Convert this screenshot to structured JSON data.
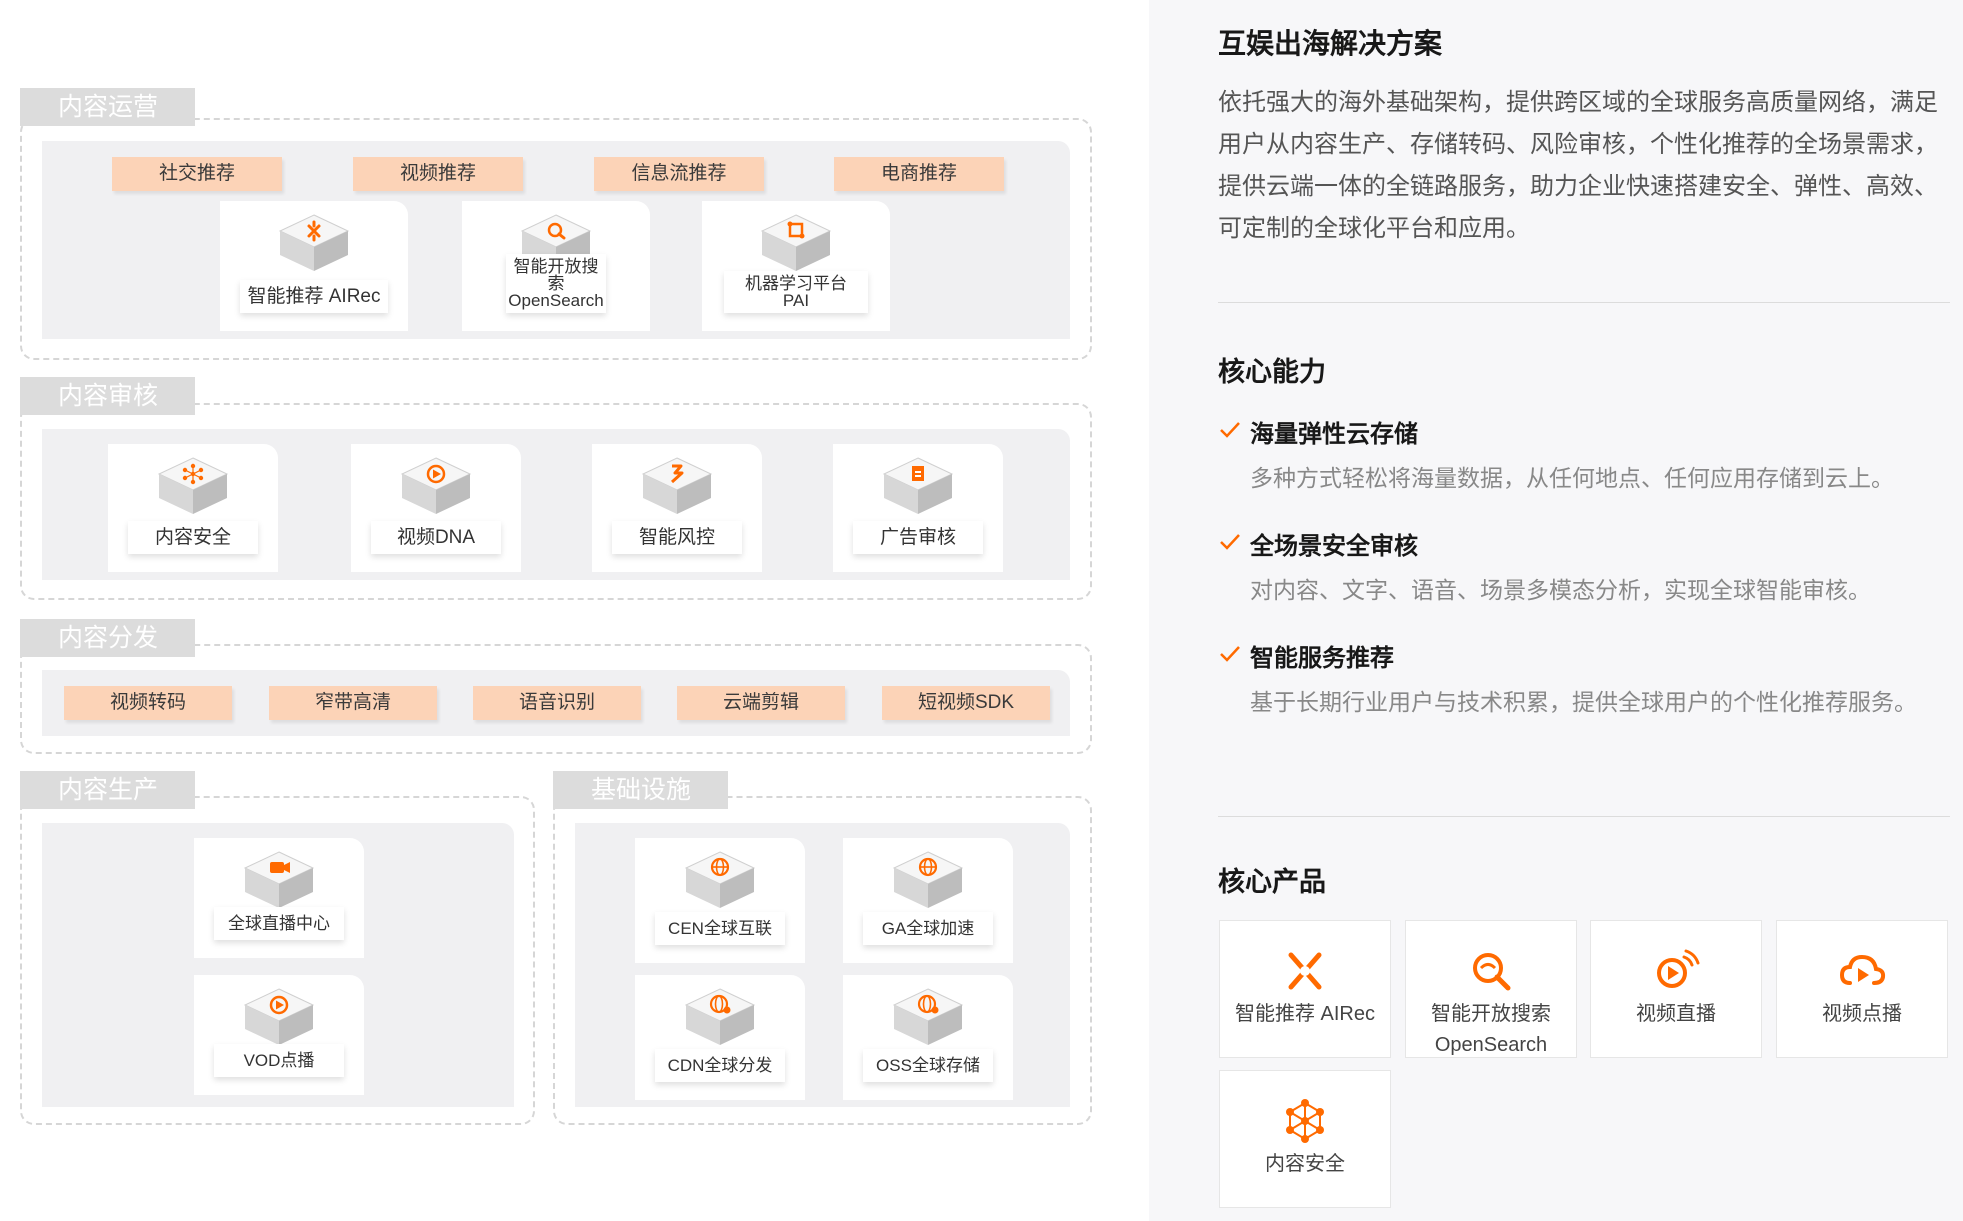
{
  "diagram": {
    "content_ops": {
      "title": "内容运营",
      "tags": [
        "社交推荐",
        "视频推荐",
        "信息流推荐",
        "电商推荐"
      ],
      "products": [
        {
          "name": "智能推荐 AIRec",
          "icon": "airec-icon"
        },
        {
          "line1": "智能开放搜索",
          "line2": "OpenSearch",
          "icon": "search-icon"
        },
        {
          "line1": "机器学习平台",
          "line2": "PAI",
          "icon": "pai-icon"
        }
      ]
    },
    "content_review": {
      "title": "内容审核",
      "products": [
        {
          "name": "内容安全",
          "icon": "network-icon"
        },
        {
          "name": "视频DNA",
          "icon": "video-play-icon"
        },
        {
          "name": "智能风控",
          "icon": "risk-control-icon"
        },
        {
          "name": "广告审核",
          "icon": "ad-review-icon"
        }
      ]
    },
    "content_dist": {
      "title": "内容分发",
      "tags": [
        "视频转码",
        "窄带高清",
        "语音识别",
        "云端剪辑",
        "短视频SDK"
      ]
    },
    "content_prod": {
      "title": "内容生产",
      "products": [
        {
          "name": "全球直播中心",
          "icon": "live-camera-icon"
        },
        {
          "name": "VOD点播",
          "icon": "vod-icon"
        }
      ]
    },
    "infra": {
      "title": "基础设施",
      "products": [
        {
          "name": "CEN全球互联",
          "icon": "globe-icon"
        },
        {
          "name": "GA全球加速",
          "icon": "globe-icon"
        },
        {
          "name": "CDN全球分发",
          "icon": "globe-gear-icon"
        },
        {
          "name": "OSS全球存储",
          "icon": "globe-gear-icon"
        }
      ]
    }
  },
  "solution": {
    "title": "互娱出海解决方案",
    "description": "依托强大的海外基础架构，提供跨区域的全球服务高质量网络，满足用户从内容生产、存储转码、风险审核，个性化推荐的全场景需求，提供云端一体的全链路服务，助力企业快速搭建安全、弹性、高效、可定制的全球化平台和应用。"
  },
  "capabilities": {
    "title": "核心能力",
    "items": [
      {
        "title": "海量弹性云存储",
        "desc": "多种方式轻松将海量数据，从任何地点、任何应用存储到云上。"
      },
      {
        "title": "全场景安全审核",
        "desc": "对内容、文字、语音、场景多模态分析，实现全球智能审核。"
      },
      {
        "title": "智能服务推荐",
        "desc": "基于长期行业用户与技术积累，提供全球用户的个性化推荐服务。"
      }
    ]
  },
  "products": {
    "title": "核心产品",
    "items": [
      {
        "line1": "智能推荐 AIRec",
        "line2": "",
        "icon": "airec-icon"
      },
      {
        "line1": "智能开放搜索",
        "line2": "OpenSearch",
        "icon": "search-icon"
      },
      {
        "line1": "视频直播",
        "line2": "",
        "icon": "live-video-icon"
      },
      {
        "line1": "视频点播",
        "line2": "",
        "icon": "cloud-play-icon"
      },
      {
        "line1": "内容安全",
        "line2": "",
        "icon": "network-icon"
      }
    ]
  },
  "colors": {
    "accent": "#ff6a00",
    "tag_bg": "#fcd3b7",
    "panel_bg": "#f0f0f2",
    "tab_bg": "#dcdcdc"
  }
}
